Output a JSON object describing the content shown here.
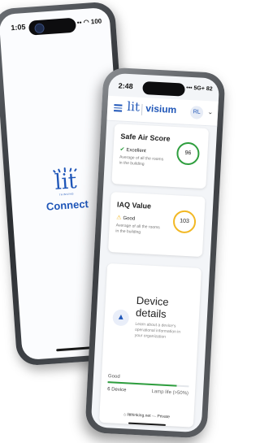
{
  "back_phone": {
    "status_time": "1:05",
    "status_right": "◉ •• ◠ 100",
    "logo_text": "lit",
    "logo_subtext": "THINKING",
    "connect_label": "Connect"
  },
  "front_phone": {
    "status_time": "2:48",
    "status_right": "••• 5G+ 82",
    "header": {
      "lit_label": "lit",
      "visium_label": "visium",
      "avatar_initials": "RL"
    },
    "cards": [
      {
        "title": "Safe Air Score",
        "status": "Excellent",
        "status_color": "#2e9e3e",
        "description": "Average of all the rooms in the building",
        "value": "96"
      },
      {
        "title": "IAQ Value",
        "status": "Good",
        "status_color": "#f2b824",
        "description": "Average of all the rooms in the building",
        "value": "103"
      }
    ],
    "device": {
      "title": "Device details",
      "description": "Learn about a device's operational information in your organization",
      "good_label": "Good",
      "good_fraction": 0.85,
      "count_label": "6 Device",
      "lamp_life": "Lamp life (>50%)"
    },
    "footer_url": "⌂ litthinking.net — Private"
  },
  "colors": {
    "brand": "#1f56b8",
    "good": "#2e9e3e",
    "warning": "#f2b824"
  }
}
